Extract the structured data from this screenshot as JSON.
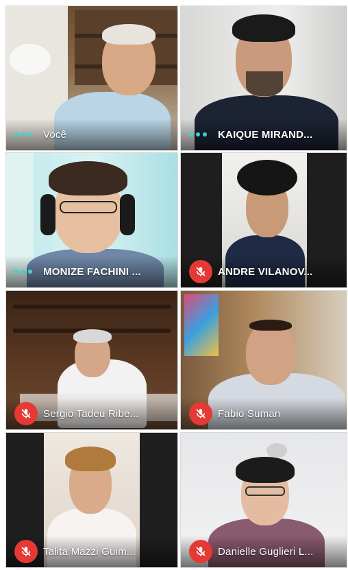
{
  "participants": [
    {
      "name": "Você",
      "status": "speaking"
    },
    {
      "name": "KAIQUE MIRAND...",
      "status": "speaking"
    },
    {
      "name": "MONIZE FACHINI ...",
      "status": "speaking"
    },
    {
      "name": "ANDRE VILANOV...",
      "status": "muted"
    },
    {
      "name": "Sergio Tadeu Ribe...",
      "status": "muted"
    },
    {
      "name": "Fabio Suman",
      "status": "muted"
    },
    {
      "name": "Talita Mazzi Guim...",
      "status": "muted"
    },
    {
      "name": "Danielle Guglieri L...",
      "status": "muted"
    }
  ],
  "icons": {
    "speaking": "speaking-dots-icon",
    "muted": "mic-off-icon"
  },
  "colors": {
    "speaking_dots": "#3fd3c6",
    "muted_badge": "#e53935"
  }
}
